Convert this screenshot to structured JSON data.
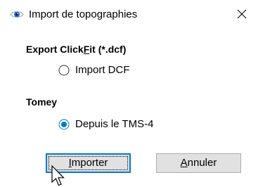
{
  "window": {
    "title": "Import de topographies",
    "icon": "eye-icon"
  },
  "groups": {
    "clickfit": {
      "label_pre": "Export Click",
      "label_mnemonic": "F",
      "label_post": "it (*.dcf)",
      "option_label": "Import DCF",
      "option_checked": false
    },
    "tomey": {
      "label": "Tomey",
      "option_label": "Depuis le TMS-4",
      "option_checked": true
    }
  },
  "buttons": {
    "import": {
      "mnemonic": "I",
      "rest": "mporter"
    },
    "cancel": {
      "mnemonic": "A",
      "rest": "nnuler"
    }
  },
  "colors": {
    "accent": "#0078d7",
    "button_face": "#e1e1e1",
    "button_border": "#adadad"
  }
}
